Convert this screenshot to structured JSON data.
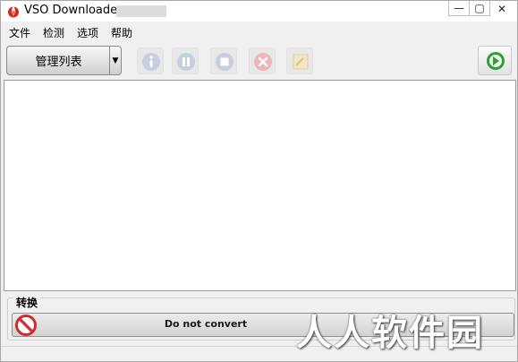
{
  "window": {
    "title": "VSO Downloader"
  },
  "title_buttons": {
    "minimize": "—",
    "maximize": "▢",
    "close": "✕"
  },
  "menu": {
    "items": [
      "文件",
      "检测",
      "选项",
      "帮助"
    ]
  },
  "toolbar": {
    "list_button_label": "管理列表",
    "dropdown_arrow": "▼"
  },
  "convert": {
    "group_label": "转换",
    "selected_option": "Do not convert"
  },
  "watermark": {
    "text": "人人软件园"
  },
  "colors": {
    "accent_blue": "#4a73b8",
    "disabled_icon": "#c6cfdf",
    "go_green": "#2f9e3a",
    "no_red": "#d22b2b"
  }
}
